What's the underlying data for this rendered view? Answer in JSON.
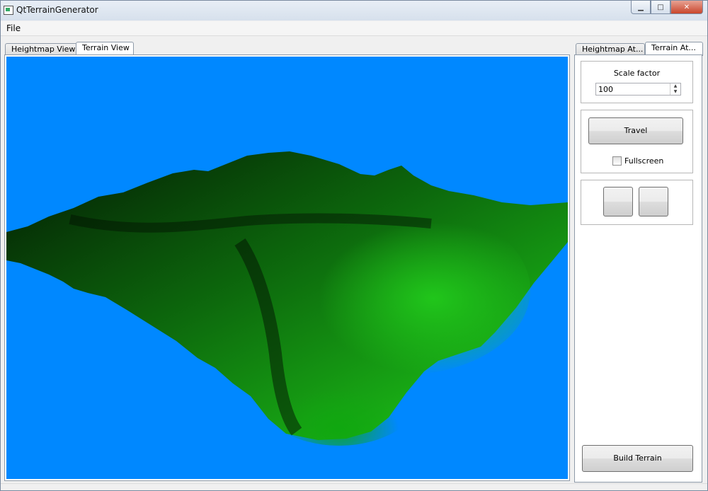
{
  "window": {
    "title": "QtTerrainGenerator"
  },
  "menu": {
    "file": "File"
  },
  "view_tabs": [
    {
      "label": "Heightmap View"
    },
    {
      "label": "Terrain View"
    }
  ],
  "side_tabs": [
    {
      "label": "Heightmap At..."
    },
    {
      "label": "Terrain At..."
    }
  ],
  "terrain": {
    "scale_label": "Scale factor",
    "scale_value": "100",
    "travel_label": "Travel",
    "fullscreen_label": "Fullscreen",
    "fullscreen_checked": false
  },
  "build_label": "Build Terrain",
  "colors": {
    "sky": "#0088ff",
    "terrain": "#18c010"
  }
}
